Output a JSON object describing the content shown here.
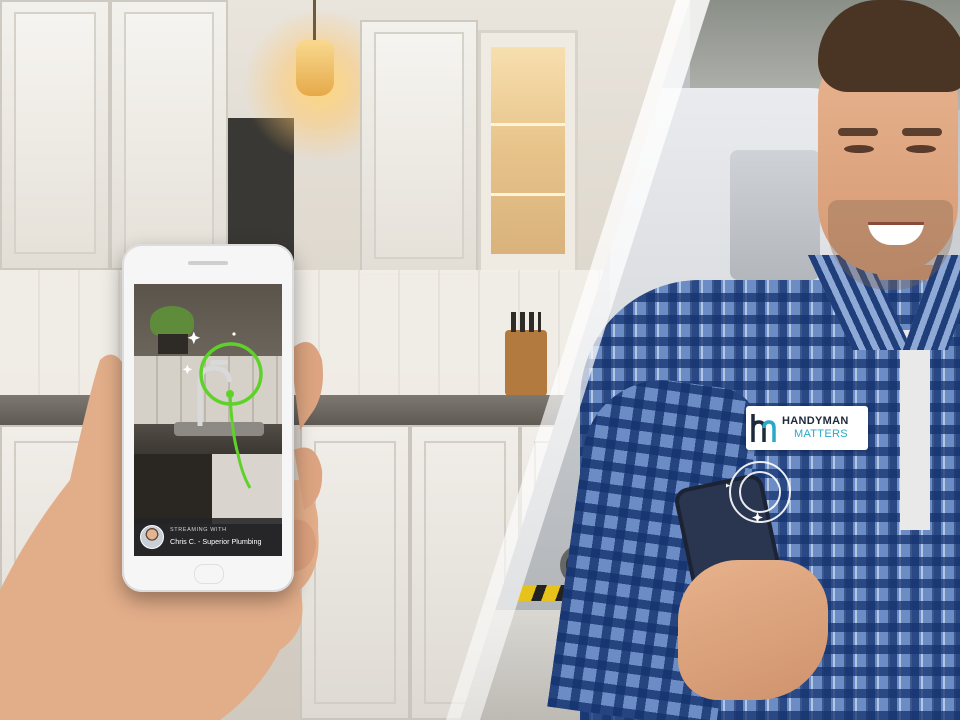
{
  "left_phone": {
    "streaming_label": "STREAMING WITH",
    "technician": "Chris C. - Superior Plumbing"
  },
  "logo": {
    "line1": "HANDYMAN",
    "line2": "MATTERS"
  },
  "colors": {
    "annotation_green": "#5fd22a",
    "logo_dark": "#1d2a3c",
    "logo_cyan": "#29a9c9",
    "shirt_blue": "#1f3e7a"
  },
  "icons": [
    "sparkle-icon",
    "circle-annotation-icon",
    "ripple-ring-icon"
  ]
}
